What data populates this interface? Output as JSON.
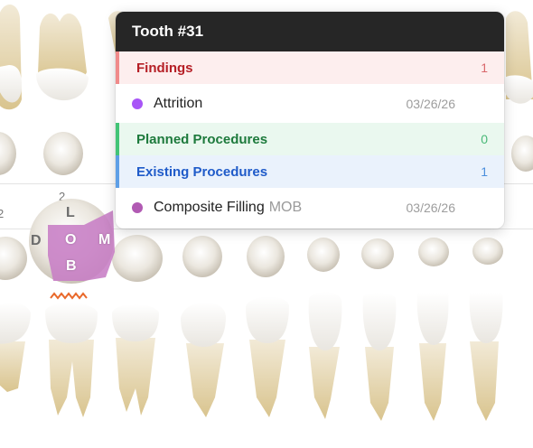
{
  "chart": {
    "visible_numbers": [
      "2",
      "2"
    ],
    "selected_tooth_surfaces": {
      "lingual": "L",
      "distal": "D",
      "occlusal": "O",
      "mesial": "M",
      "buccal": "B"
    },
    "highlight_color": "#c77dc5"
  },
  "popup": {
    "title": "Tooth #31",
    "sections": {
      "findings": {
        "label": "Findings",
        "count": "1",
        "accent": "#f08b8b"
      },
      "planned": {
        "label": "Planned Procedures",
        "count": "0",
        "accent": "#43c477"
      },
      "existing": {
        "label": "Existing Procedures",
        "count": "1",
        "accent": "#5e9fe6"
      }
    },
    "findings_items": [
      {
        "name": "Attrition",
        "date": "03/26/26",
        "dot_color": "#a855f7"
      }
    ],
    "existing_items": [
      {
        "name": "Composite Filling",
        "surface": "MOB",
        "date": "03/26/26",
        "dot_color": "#b15ab3"
      }
    ]
  }
}
